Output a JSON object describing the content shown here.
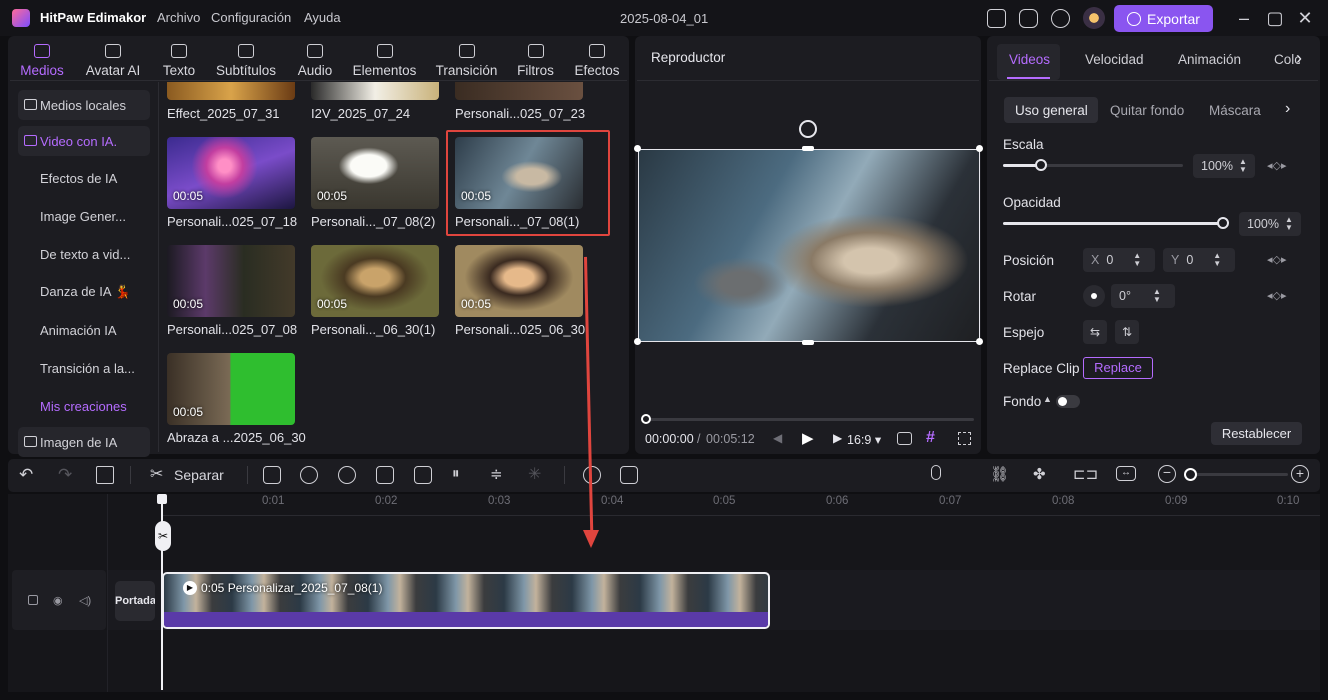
{
  "titlebar": {
    "app_name": "HitPaw Edimakor",
    "menus": [
      "Archivo",
      "Configuración",
      "Ayuda"
    ],
    "project_name": "2025-08-04_01",
    "export_label": "Exportar",
    "window_controls": [
      "minimize-icon",
      "maximize-icon",
      "close-icon"
    ]
  },
  "media_tabs": [
    {
      "label": "Medios",
      "active": true
    },
    {
      "label": "Avatar AI"
    },
    {
      "label": "Texto"
    },
    {
      "label": "Subtítulos"
    },
    {
      "label": "Audio"
    },
    {
      "label": "Elementos"
    },
    {
      "label": "Transición"
    },
    {
      "label": "Filtros"
    },
    {
      "label": "Efectos"
    }
  ],
  "sidebar": {
    "items": [
      {
        "label": "Medios locales"
      },
      {
        "label": "Video con IA.",
        "active": true
      },
      {
        "label": "Efectos de IA"
      },
      {
        "label": "Image Gener..."
      },
      {
        "label": "De texto a vid..."
      },
      {
        "label": "Danza de IA 💃"
      },
      {
        "label": "Animación IA"
      },
      {
        "label": "Transición a la..."
      },
      {
        "label": "Mis creaciones",
        "highlight": true
      },
      {
        "label": "Imagen de IA"
      }
    ]
  },
  "media_grid": {
    "top_row_labels": [
      "Effect_2025_07_31",
      "I2V_2025_07_24",
      "Personali...025_07_23"
    ],
    "items": [
      {
        "label": "Personali...025_07_18",
        "duration": "00:05"
      },
      {
        "label": "Personali..._07_08(2)",
        "duration": "00:05"
      },
      {
        "label": "Personali..._07_08(1)",
        "duration": "00:05",
        "selected": true
      },
      {
        "label": "Personali...025_07_08",
        "duration": "00:05"
      },
      {
        "label": "Personali..._06_30(1)",
        "duration": "00:05"
      },
      {
        "label": "Personali...025_06_30",
        "duration": "00:05"
      },
      {
        "label": "Abraza a ...2025_06_30",
        "duration": "00:05"
      }
    ]
  },
  "player": {
    "title": "Reproductor",
    "current_time": "00:00:00",
    "separator": "/",
    "total_time": "00:05:12",
    "aspect": "16:9"
  },
  "properties": {
    "tabs": [
      "Videos",
      "Velocidad",
      "Animación",
      "Colo"
    ],
    "subtabs": [
      "Uso general",
      "Quitar fondo",
      "Máscara"
    ],
    "escala": {
      "label": "Escala",
      "value": "100%",
      "level": 0.0
    },
    "opacidad": {
      "label": "Opacidad",
      "value": "100%",
      "level": 1.0
    },
    "posicion": {
      "label": "Posición",
      "x_label": "X",
      "x": "0",
      "y_label": "Y",
      "y": "0"
    },
    "rotar": {
      "label": "Rotar",
      "value": "0°"
    },
    "espejo": {
      "label": "Espejo"
    },
    "replace": {
      "label": "Replace Clip",
      "button": "Replace"
    },
    "fondo": {
      "label": "Fondo"
    },
    "reset": "Restablecer"
  },
  "timeline": {
    "separar": "Separar",
    "ticks": [
      "0:01",
      "0:02",
      "0:03",
      "0:04",
      "0:05",
      "0:06",
      "0:07",
      "0:08",
      "0:09",
      "0:10"
    ],
    "cover_label": "Portada",
    "clip_label": "0:05 Personalizar_2025_07_08(1)"
  },
  "colors": {
    "accent": "#8a55f0",
    "active_text": "#b56cff",
    "highlight_box": "#e0453e",
    "clip_bar": "#5a3aa8"
  }
}
